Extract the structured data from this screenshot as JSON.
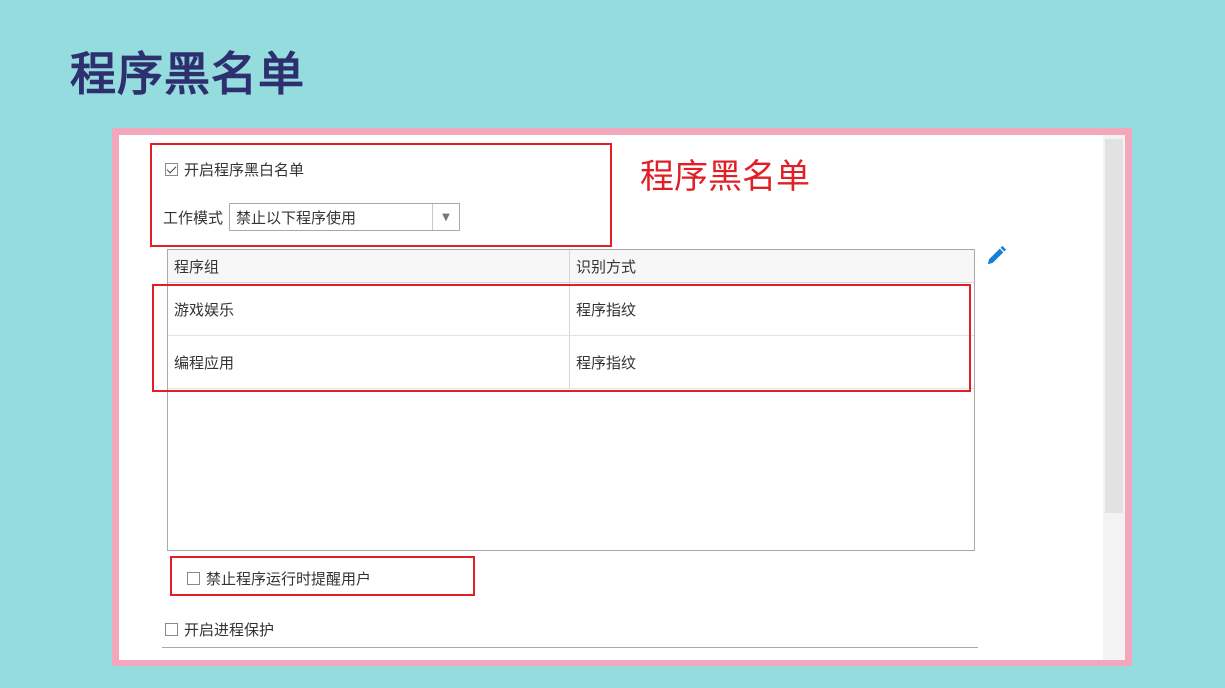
{
  "slide": {
    "title": "程序黑名单"
  },
  "annotation": {
    "label": "程序黑名单"
  },
  "settings": {
    "enable_list_label": "开启程序黑白名单",
    "enable_list_checked": true,
    "work_mode_label": "工作模式",
    "work_mode_value": "禁止以下程序使用",
    "notify_label": "禁止程序运行时提醒用户",
    "notify_checked": false,
    "process_protect_label": "开启进程保护",
    "process_protect_checked": false
  },
  "table": {
    "headers": [
      "程序组",
      "识别方式"
    ],
    "rows": [
      {
        "group": "游戏娱乐",
        "method": "程序指纹"
      },
      {
        "group": "编程应用",
        "method": "程序指纹"
      }
    ]
  },
  "icons": {
    "edit": "pencil-icon",
    "dropdown": "chevron-down-icon"
  },
  "colors": {
    "background": "#94dcde",
    "title": "#2e2f6e",
    "frame": "#f2a7bd",
    "highlight": "#e01f26",
    "edit_icon": "#1a7fd0"
  }
}
